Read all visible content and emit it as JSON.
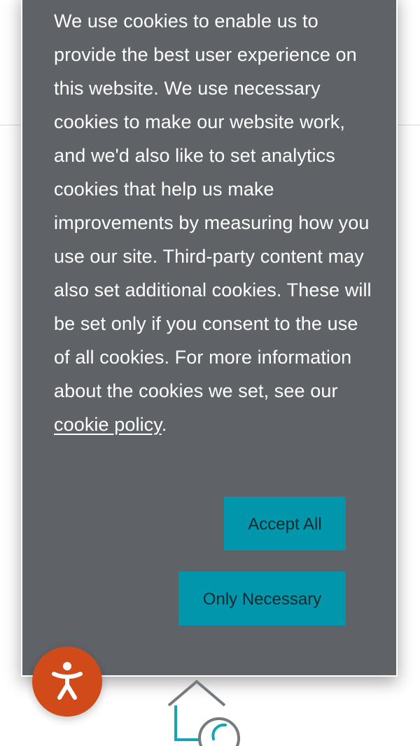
{
  "cookie_banner": {
    "message": "We use cookies to enable us to provide the best user experience on this website. We use necessary cookies to make our website work, and we'd also like to set analytics cookies that help us make improvements by measuring how you use our site. Third-party content may also set additional cookies. These will be set only if you consent to the use of all cookies. For more information about the cookies we set, see our ",
    "policy_link_text": "cookie policy",
    "message_end": ".",
    "accept_all_label": "Accept All",
    "only_necessary_label": "Only Necessary"
  },
  "accessibility": {
    "icon": "accessibility-icon"
  },
  "footer": {
    "logo_icon": "house-logo-icon"
  },
  "colors": {
    "banner_background": "#5f6367",
    "button_background": "#0097ad",
    "accessibility_button": "#d14b1a",
    "logo_teal": "#13a4b6",
    "logo_gray": "#777a7e"
  }
}
